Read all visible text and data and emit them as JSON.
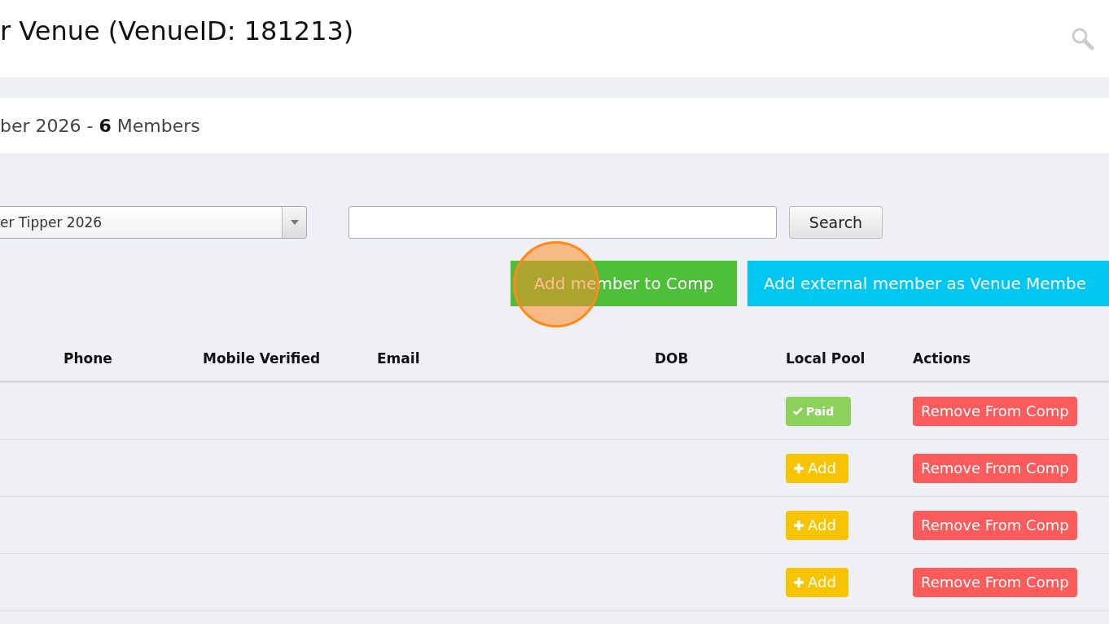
{
  "page_title": "r Venue (VenueID: 181213)",
  "subtitle": {
    "text": "ber 2026 - ",
    "count": "6",
    "suffix": " Members"
  },
  "filters": {
    "competition_select": {
      "value": "er Tipper 2026"
    },
    "search_button": "Search"
  },
  "actions": [
    {
      "kind": "add-member",
      "label": "Add member to Comp"
    },
    {
      "kind": "add-external",
      "label": "Add external member as Venue Membe"
    }
  ],
  "table": {
    "columns": [
      "",
      "Phone",
      "Mobile Verified",
      "Email",
      "DOB",
      "Local Pool",
      "Actions"
    ],
    "rows": [
      {
        "local_pool": {
          "kind": "paid",
          "label": "Paid"
        },
        "action": "Remove From Comp"
      },
      {
        "local_pool": {
          "kind": "add",
          "label": "Add"
        },
        "action": "Remove From Comp"
      },
      {
        "local_pool": {
          "kind": "add",
          "label": "Add"
        },
        "action": "Remove From Comp"
      },
      {
        "local_pool": {
          "kind": "add",
          "label": "Add"
        },
        "action": "Remove From Comp"
      }
    ]
  }
}
